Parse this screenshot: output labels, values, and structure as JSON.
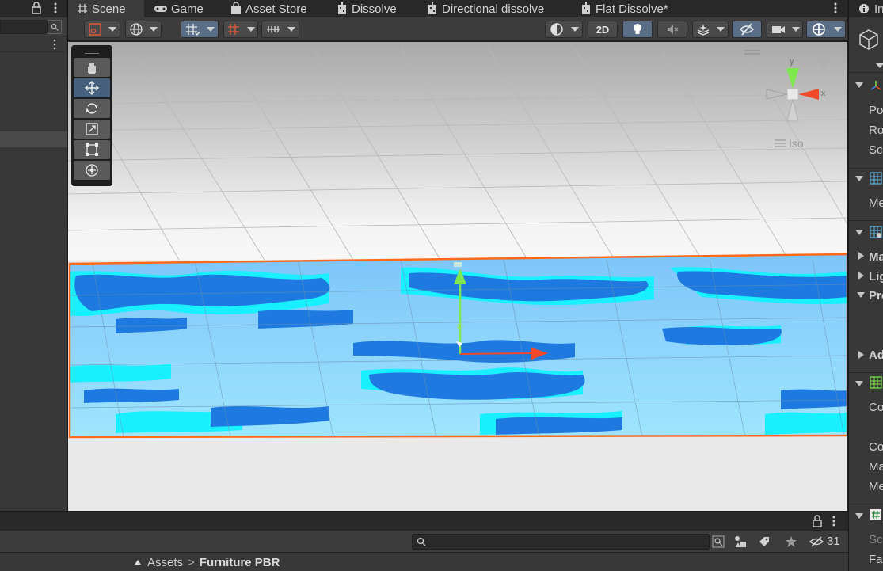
{
  "scene_tabs": [
    {
      "label": "Scene",
      "icon": "grid-hash-icon",
      "active": true
    },
    {
      "label": "Game",
      "icon": "gamepad-icon",
      "active": false
    },
    {
      "label": "Asset Store",
      "icon": "shopping-bag-icon",
      "active": false
    },
    {
      "label": "Dissolve",
      "icon": "shader-graph-icon",
      "active": false
    },
    {
      "label": "Directional dissolve",
      "icon": "shader-graph-icon",
      "active": false
    },
    {
      "label": "Flat Dissolve*",
      "icon": "shader-graph-icon",
      "active": false
    }
  ],
  "scene_toolbar": {
    "mode_2d_label": "2D"
  },
  "scene_view": {
    "orientation_label": "Iso",
    "gizmo_axes": {
      "y": "y",
      "x": "x"
    }
  },
  "inspector": {
    "tab_label": "In",
    "rows": [
      {
        "label": "Po",
        "bold": false
      },
      {
        "label": "Ro",
        "bold": false
      },
      {
        "label": "Sc",
        "bold": false
      },
      {
        "label": "Me",
        "bold": false
      },
      {
        "label": "Ma",
        "bold": true
      },
      {
        "label": "Lig",
        "bold": true
      },
      {
        "label": "Pro",
        "bold": true
      },
      {
        "label": "Ad",
        "bold": true
      },
      {
        "label": "Co",
        "bold": false
      },
      {
        "label": "Co",
        "bold": false
      },
      {
        "label": "Ma",
        "bold": false
      },
      {
        "label": "Me",
        "bold": false
      },
      {
        "label": "Sc",
        "bold": false
      },
      {
        "label": "Fa",
        "bold": false
      }
    ]
  },
  "project_panel": {
    "search_value": "",
    "hidden_count": "31",
    "breadcrumb": [
      "Assets",
      "Furniture PBR"
    ]
  },
  "colors": {
    "selection_outline": "#ff6a1a",
    "water_light": "#7cc4f8",
    "water_dark": "#1e7ae0",
    "water_cyan": "#18f0ff",
    "gizmo_y": "#7ee84e",
    "gizmo_x": "#f04a2a"
  }
}
